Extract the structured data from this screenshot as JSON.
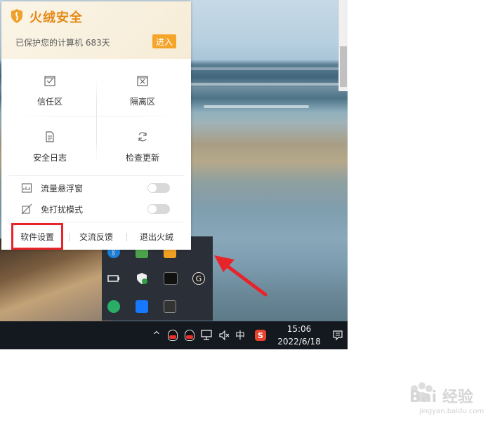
{
  "panel": {
    "brand": "火绒安全",
    "protect_text": "已保护您的计算机 683天",
    "enter_label": "进入",
    "grid": [
      {
        "label": "信任区",
        "icon": "trust-zone-icon"
      },
      {
        "label": "隔离区",
        "icon": "quarantine-icon"
      },
      {
        "label": "安全日志",
        "icon": "log-icon"
      },
      {
        "label": "检查更新",
        "icon": "refresh-icon"
      }
    ],
    "toggles": [
      {
        "label": "流量悬浮窗",
        "icon": "traffic-chart-icon",
        "on": false
      },
      {
        "label": "免打扰模式",
        "icon": "dnd-icon",
        "on": false
      }
    ],
    "footer": {
      "settings": "软件设置",
      "feedback": "交流反馈",
      "exit": "退出火绒"
    }
  },
  "taskbar": {
    "ime": "中",
    "time": "15:06",
    "date": "2022/6/18",
    "sogou": "S"
  },
  "watermark": {
    "text": "Bai 经验",
    "url": "jingyan.baidu.com"
  },
  "colors": {
    "brand_orange": "#e58a16",
    "enter_button": "#f5a52a",
    "highlight_red": "#e8242b",
    "taskbar": "#14191f"
  }
}
